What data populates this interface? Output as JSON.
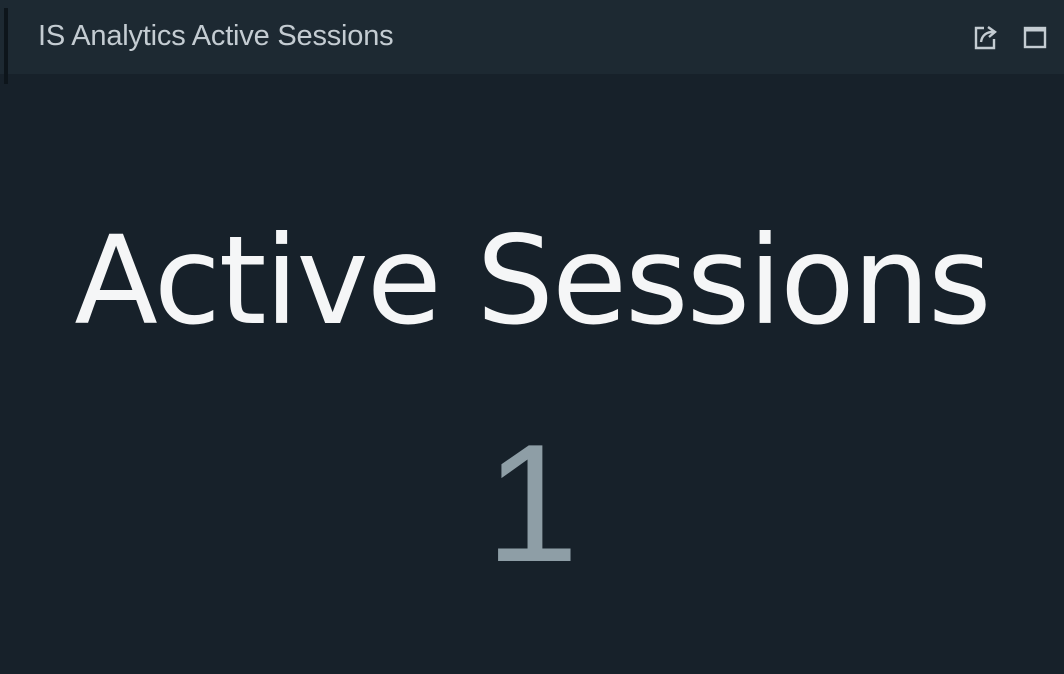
{
  "widget": {
    "title": "IS Analytics Active Sessions",
    "label": "Active Sessions",
    "value": "1",
    "header_icons": [
      "export-icon",
      "maximize-icon"
    ]
  },
  "colors": {
    "background": "#17212a",
    "header_background": "#1d2932",
    "title_text": "#c4ccd2",
    "label_text": "#f5f6f7",
    "value_text": "#8e9ea6",
    "icon": "#c4ccd2"
  }
}
